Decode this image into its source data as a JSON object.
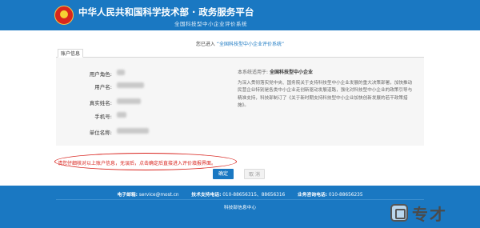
{
  "header": {
    "title": "中华人民共和国科学技术部 · 政务服务平台",
    "subtitle": "全国科技型中小企业评价系统"
  },
  "entered": {
    "prefix": "您已进入",
    "system": "“全国科技型中小企业评价系统”"
  },
  "tab": {
    "label": "账户信息"
  },
  "form": {
    "fields": [
      {
        "label": "用户角色:"
      },
      {
        "label": "用户名:"
      },
      {
        "label": "真实姓名:"
      },
      {
        "label": "手机号:"
      },
      {
        "label": "单位名称:"
      }
    ]
  },
  "info": {
    "applies_label": "本系统适用于:",
    "applies_value": "全国科技型中小企业",
    "description": "为深入贯彻落实党中央、国务院关于支持科技型中小企业发展的重大决策部署，加快推动民营企业特别是各类中小企业走创新驱动发展道路，强化对科技型中小企业的政策引导与精准支持，科技部制订了《关于新时期支持科技型中小企业加快创新发展的若干政策措施》。"
  },
  "notice": {
    "text": "请您仔细核对以上账户信息，无误后，点击确定后直接进入评价填报界面。"
  },
  "buttons": {
    "confirm": "确定",
    "cancel": "取 消"
  },
  "footer": {
    "email_label": "电子邮箱:",
    "email_value": "service@most.cn",
    "tech_label": "技术支持电话:",
    "tech_value": "010-88656315、88656316",
    "business_label": "业务咨询电话:",
    "business_value": "010-88656235",
    "org": "科技部信息中心"
  },
  "watermark": {
    "text": "专才",
    "icon": "watermark-logo"
  },
  "colors": {
    "primary": "#1a78c2",
    "alert": "#d8221c"
  }
}
